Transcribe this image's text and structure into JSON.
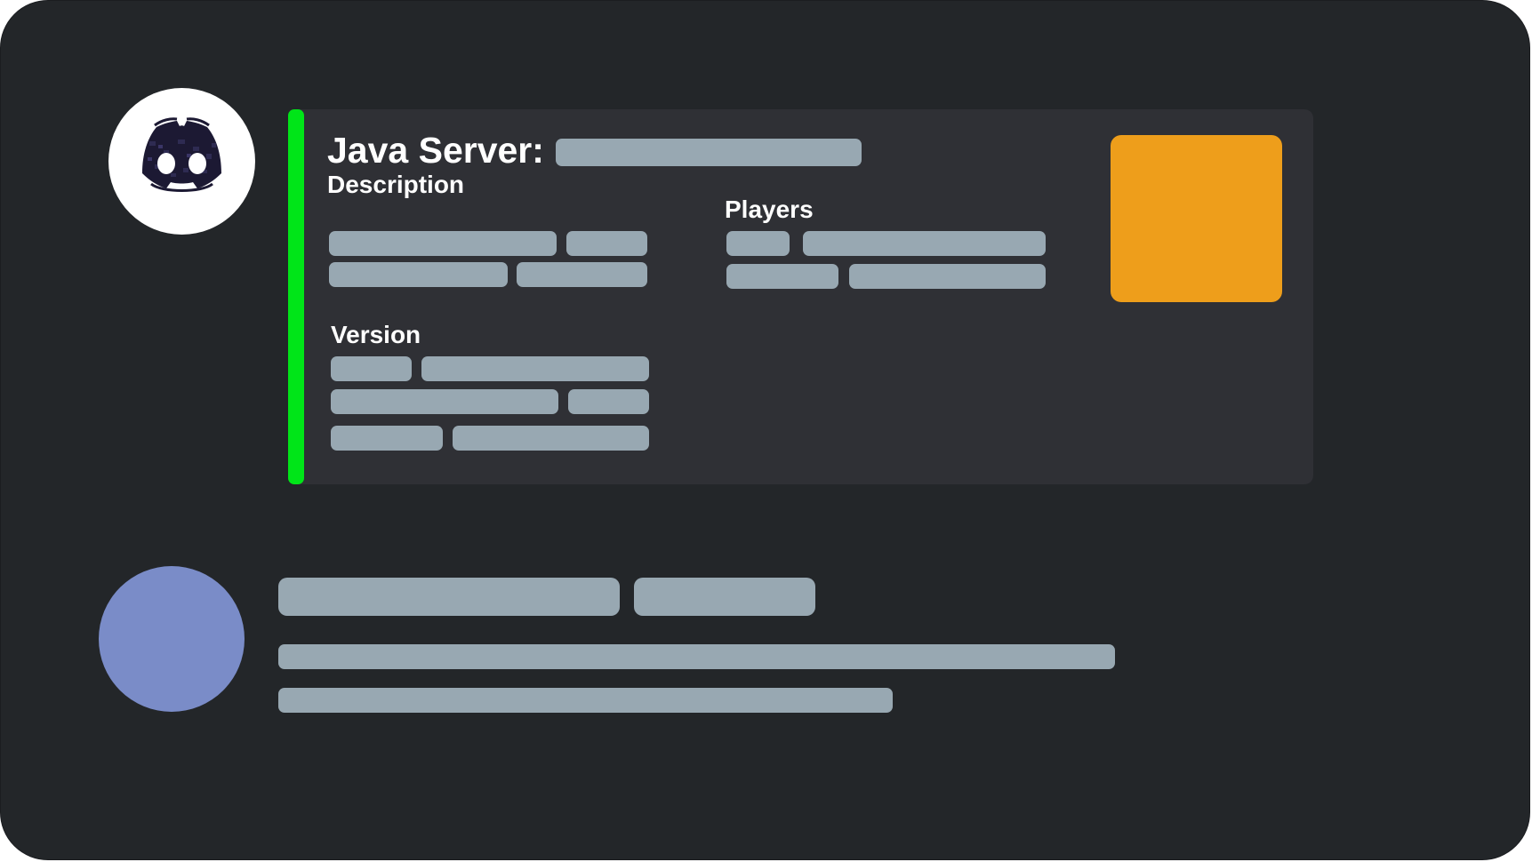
{
  "embed": {
    "title": "Java Server:",
    "accent_color": "#00e518",
    "thumbnail_color": "#ee9e1b",
    "fields": {
      "description": "Description",
      "players": "Players",
      "version": "Version"
    }
  },
  "bot_avatar": {
    "icon": "discord-logo-icon",
    "background": "#ffffff"
  },
  "user_avatar": {
    "color": "#7a8cc8"
  },
  "colors": {
    "background": "#232629",
    "embed_background": "#2f3035",
    "placeholder": "#98a8b2"
  }
}
